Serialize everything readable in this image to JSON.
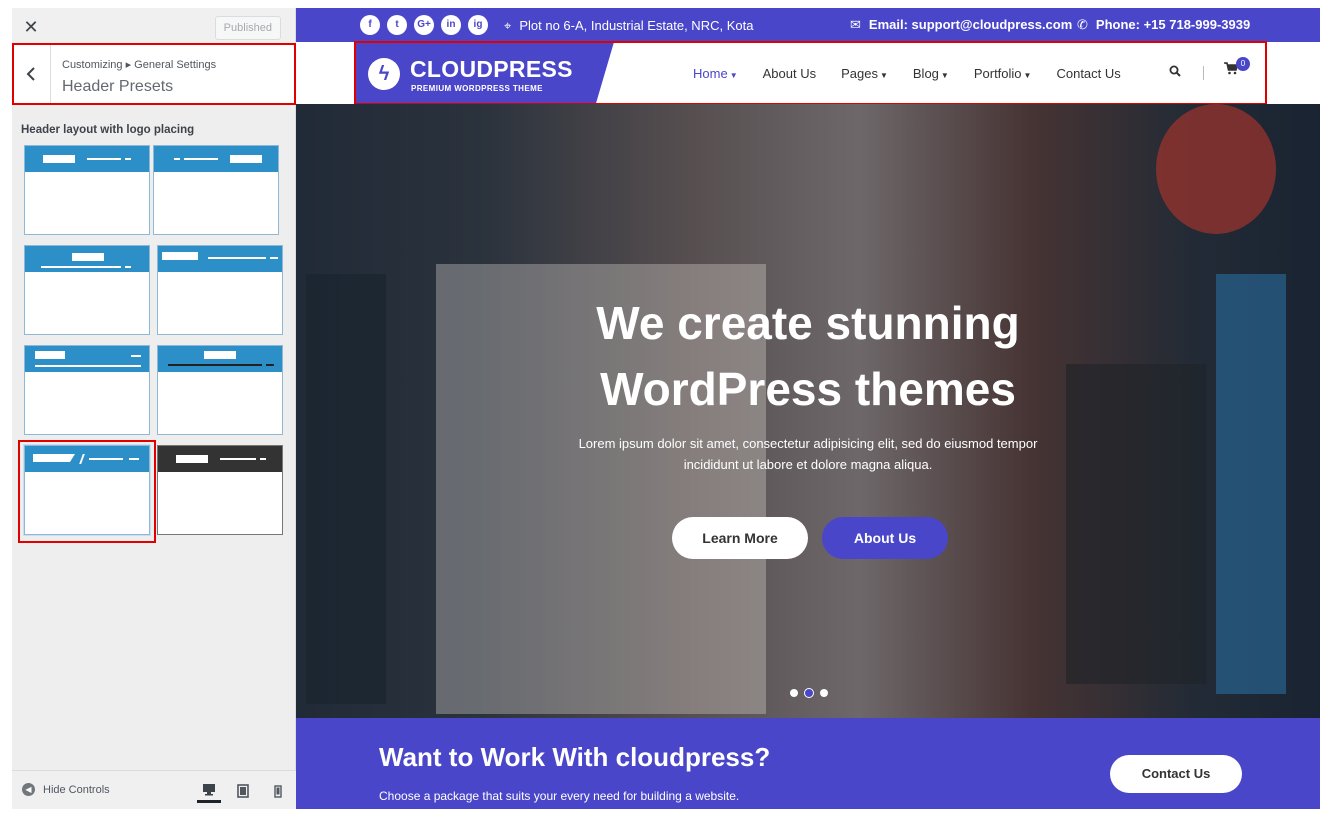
{
  "customizer": {
    "close_icon": "close-icon",
    "publish_label": "Published",
    "breadcrumb": "Customizing ▸ General Settings",
    "section_title": "Header Presets",
    "group_label": "Header layout with logo placing",
    "hide_controls_label": "Hide Controls",
    "devices": [
      "desktop",
      "tablet",
      "mobile"
    ],
    "active_device": "desktop",
    "selected_preset": 7,
    "preset_count": 8
  },
  "site": {
    "topbar": {
      "social": [
        "f",
        "t",
        "G+",
        "in",
        "ig"
      ],
      "address": "Plot no 6-A, Industrial Estate, NRC, Kota",
      "email": "Email: support@cloudpress.com",
      "phone": "Phone: +15 718-999-3939"
    },
    "logo": {
      "name": "CLOUDPRESS",
      "tagline": "PREMIUM WORDPRESS THEME"
    },
    "nav": {
      "items": [
        "Home",
        "About Us",
        "Pages",
        "Blog",
        "Portfolio",
        "Contact Us"
      ],
      "cart_count": "0"
    },
    "hero": {
      "title_line1": "We create stunning",
      "title_line2": "WordPress themes",
      "subtitle": "Lorem ipsum dolor sit amet, consectetur adipisicing elit, sed do eiusmod tempor incididunt ut labore et dolore magna aliqua.",
      "btn_learn": "Learn More",
      "btn_about": "About Us",
      "active_slide": 2,
      "slide_count": 3
    },
    "cta": {
      "title": "Want to Work With cloudpress?",
      "subtitle": "Choose a package that suits your every need for building a website.",
      "button": "Contact Us"
    }
  },
  "colors": {
    "brand": "#4a46c9",
    "customizer_bg": "#eeeeee",
    "preset_blue": "#2d8fc7",
    "highlight_red": "#e00000"
  }
}
